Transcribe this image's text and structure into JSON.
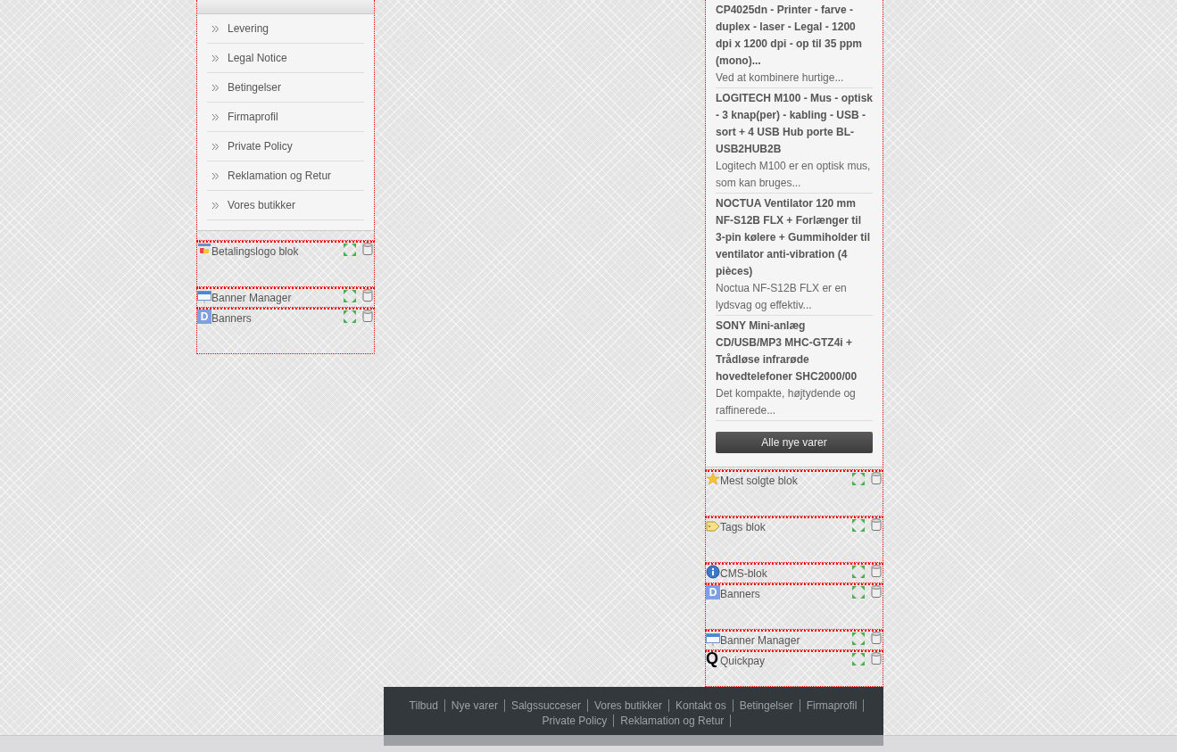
{
  "information_menu": {
    "items": [
      {
        "label": "Levering"
      },
      {
        "label": "Legal Notice"
      },
      {
        "label": "Betingelser"
      },
      {
        "label": "Firmaprofil"
      },
      {
        "label": "Private Policy"
      },
      {
        "label": "Reklamation og Retur"
      },
      {
        "label": "Vores butikker"
      }
    ]
  },
  "left_blocks": [
    {
      "title": "Betalingslogo blok",
      "kind": "payment"
    },
    {
      "title": "Banner Manager",
      "kind": "banner"
    },
    {
      "title": "Banners",
      "kind": "tile",
      "glyph": "D"
    }
  ],
  "new_products": {
    "products": [
      {
        "title": "CP4025dn - Printer - farve - duplex - laser - Legal - 1200 dpi x 1200 dpi - op til 35 ppm (mono)...",
        "description": "Ved at kombinere hurtige..."
      },
      {
        "title": "LOGITECH M100 - Mus - optisk - 3 knap(per) - kabling - USB - sort + 4 USB Hub porte BL-USB2HUB2B",
        "description": "Logitech M100 er en optisk mus, som kan bruges..."
      },
      {
        "title": "NOCTUA Ventilator 120 mm NF-S12B FLX + Forlænger til 3-pin kølere + Gummiholder til ventilator anti-vibration (4 pièces)",
        "description": "Noctua NF-S12B FLX er en lydsvag og effektiv..."
      },
      {
        "title": "SONY Mini-anlæg CD/USB/MP3 MHC-GTZ4i + Trådløse infrarøde hovedtelefoner SHC2000/00",
        "description": "Det kompakte, højtydende og raffinerede..."
      }
    ],
    "button": "Alle nye varer"
  },
  "right_blocks": [
    {
      "title": "Mest solgte blok",
      "kind": "bestseller"
    },
    {
      "title": "Tags blok",
      "kind": "tags"
    },
    {
      "title": "CMS-blok",
      "kind": "cms"
    },
    {
      "title": "Banners",
      "kind": "tile",
      "glyph": "D"
    },
    {
      "title": "Banner Manager",
      "kind": "banner"
    },
    {
      "title": "Quickpay",
      "kind": "payment-module",
      "glyph": "Q"
    }
  ],
  "footer_links": [
    {
      "label": "Tilbud"
    },
    {
      "label": "Nye varer"
    },
    {
      "label": "Salgssucceser"
    },
    {
      "label": "Vores butikker"
    },
    {
      "label": "Kontakt os"
    },
    {
      "label": "Betingelser"
    },
    {
      "label": "Firmaprofil"
    },
    {
      "label": "Private Policy"
    },
    {
      "label": "Reklamation og Retur"
    }
  ]
}
